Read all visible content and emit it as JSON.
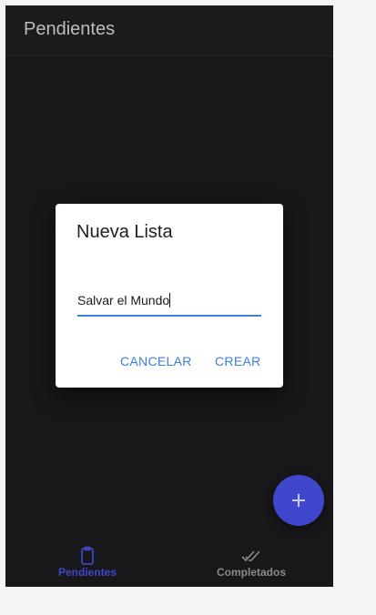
{
  "header": {
    "title": "Pendientes"
  },
  "dialog": {
    "title": "Nueva Lista",
    "input_value": "Salvar el Mundo",
    "cancel_label": "CANCELAR",
    "create_label": "CREAR"
  },
  "fab": {
    "icon": "plus-icon"
  },
  "bottom_nav": {
    "items": [
      {
        "label": "Pendientes",
        "icon": "clipboard-icon",
        "active": true
      },
      {
        "label": "Completados",
        "icon": "done-all-icon",
        "active": false
      }
    ]
  },
  "colors": {
    "accent": "#3f48cc",
    "link": "#3b7fe0",
    "app_background": "#1c1c1f"
  }
}
